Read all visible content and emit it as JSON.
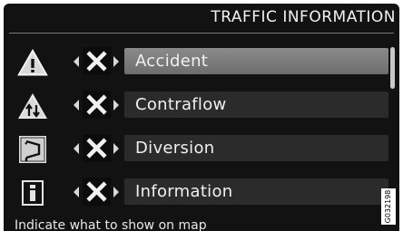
{
  "header": {
    "title": "TRAFFIC INFORMATION"
  },
  "items": [
    {
      "label": "Accident",
      "icon": "warning-triangle-icon",
      "toggle_icon": "x-icon",
      "selected": true
    },
    {
      "label": "Contraflow",
      "icon": "contraflow-icon",
      "toggle_icon": "x-icon",
      "selected": false
    },
    {
      "label": "Diversion",
      "icon": "diversion-icon",
      "toggle_icon": "x-icon",
      "selected": false
    },
    {
      "label": "Information",
      "icon": "information-icon",
      "toggle_icon": "x-icon",
      "selected": false
    }
  ],
  "status": {
    "text": "Indicate what to show on map"
  },
  "image_code": "G032198",
  "colors": {
    "background": "#121212",
    "selected_row": "#7c7c7c",
    "row": "#2b2b2b",
    "text": "#f0f0f0"
  }
}
